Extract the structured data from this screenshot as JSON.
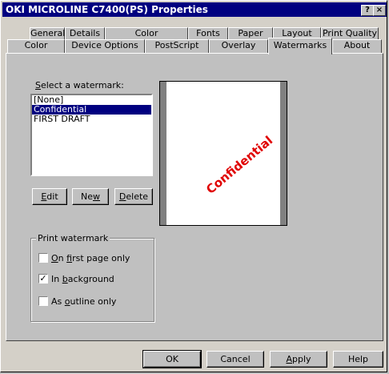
{
  "window": {
    "title": "OKI MICROLINE C7400(PS) Properties",
    "help_button": "?",
    "close_button": "×"
  },
  "tabs_row1": [
    "General",
    "Details",
    "Color Management",
    "Fonts",
    "Paper",
    "Layout",
    "Print Quality"
  ],
  "tabs_row2": [
    "Color",
    "Device Options",
    "PostScript",
    "Overlay",
    "Watermarks",
    "About"
  ],
  "active_tab": "Watermarks",
  "watermark": {
    "select_label": "Select a watermark:",
    "items": [
      "[None]",
      "Confidential",
      "FIRST DRAFT"
    ],
    "selected": "Confidential",
    "preview_text": "Confidential",
    "preview_color": "#e00000",
    "edit_label": "Edit",
    "new_label": "New",
    "delete_label": "Delete"
  },
  "print_watermark": {
    "group_title": "Print watermark",
    "first_page_only": {
      "label": "On first page only",
      "checked": false
    },
    "in_background": {
      "label": "In background",
      "checked": true
    },
    "as_outline_only": {
      "label": "As outline only",
      "checked": false
    }
  },
  "footer": {
    "ok_label": "OK",
    "cancel_label": "Cancel",
    "apply_label": "Apply",
    "help_label": "Help"
  }
}
